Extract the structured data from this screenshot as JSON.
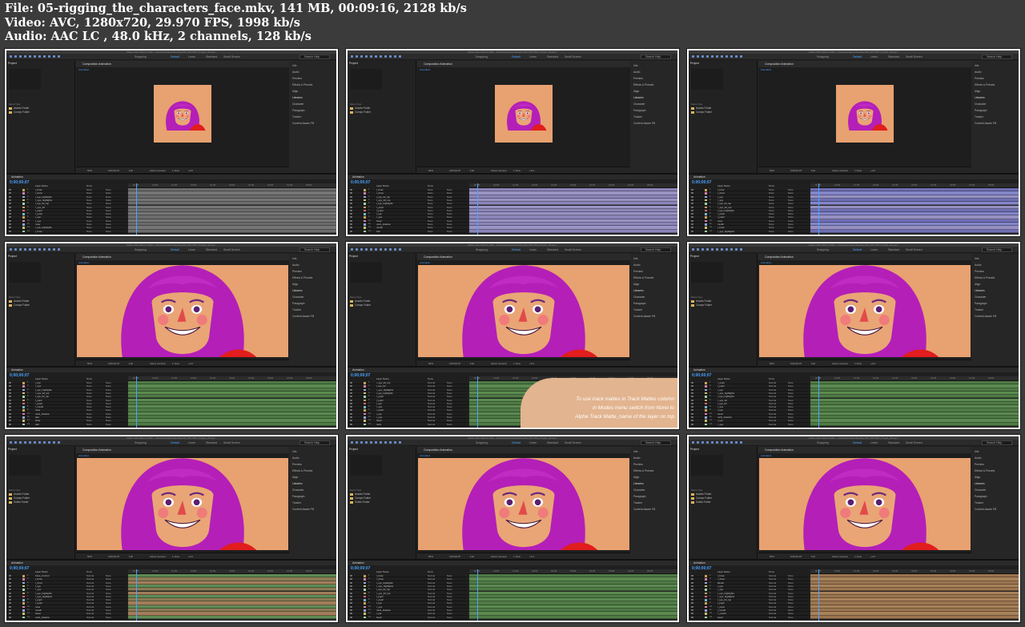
{
  "info": {
    "line1": "File: 05-rigging_the_characters_face.mkv, 141 MB, 00:09:16, 2128 kb/s",
    "line2": "Video: AVC, 1280x720, 29.970 FPS, 1998 kb/s",
    "line3": "Audio: AAC LC , 48.0 kHz, 2 channels, 128 kb/s"
  },
  "app": {
    "title": "Adobe After Effects 2020 - /Users/animation/Desktop/SS_MOTION_Project_02.aep *",
    "workspaces": [
      "Default",
      "Learn",
      "Standard",
      "Small Screen"
    ],
    "search_placeholder": "Search Help",
    "snapping": "Snapping",
    "project_label": "Project",
    "comp_tab": "Composition Animation",
    "comp_sub": "Animation",
    "timeline_tab": "Animation",
    "timecode": "0;00;00;07",
    "zoom": "50%",
    "resolution": "Full",
    "camera": "Active Camera",
    "views": "1 View",
    "offset": "+0.0",
    "columns": {
      "name": "Name",
      "type": "Type",
      "layer_name": "Layer Name",
      "mode": "Mode",
      "parent": "Parent & Link"
    },
    "folders": [
      {
        "name": "Assets",
        "type": "Folder"
      },
      {
        "name": "Comps",
        "type": "Folder"
      },
      {
        "name": "Solids",
        "type": "Folder"
      }
    ],
    "right_panel": [
      "Info",
      "Audio",
      "Preview",
      "Effects & Presets",
      "Align",
      "Libraries",
      "Character",
      "Paragraph",
      "Tracker",
      "Content-Aware Fill"
    ],
    "ruler_ticks": [
      "00:15f",
      "01:00f",
      "01:15f",
      "02:00f",
      "02:15f",
      "03:00f",
      "03:15f",
      "04:00f",
      "04:15f",
      "05:00f"
    ],
    "modes": [
      "None",
      "Normal",
      "Alpha"
    ]
  },
  "overlay": {
    "line1": "To use track mattes in Track Mattes column",
    "line2": "in Modes menu switch from None to",
    "line3": "Alpha Track Matte_name of the layer on top"
  },
  "thumbnails": [
    {
      "zoom": "full",
      "layers": [
        "l_brow",
        "r_brow",
        "l_eye_highlights",
        "r_eye_highlights",
        "l_eye_lid_top",
        "r_eye_lid",
        "l_pupil",
        "r_pupil",
        "l_eye",
        "r_eye",
        "nose",
        "l_eye_highlights",
        "l_brow"
      ],
      "tracks": "grey"
    },
    {
      "zoom": "full",
      "layers": [
        "l_brow",
        "r_brow",
        "l_eye_lid_top",
        "r_eye_lid_top",
        "l_eye_highlights",
        "r_pupil",
        "l_pupil",
        "l_eye",
        "r_eye",
        "head",
        "neck_shadow",
        "mouth",
        "hair"
      ],
      "tracks": "purple"
    },
    {
      "zoom": "full",
      "layers": [
        "l_brow",
        "r_brow",
        "l_eye",
        "r_eye",
        "l_eye_lid_top",
        "r_eye_lid_top",
        "l_eye_highlights",
        "r_pupil",
        "l_pupil",
        "nose",
        "mouth",
        "l_brow",
        "r_eye_highlights"
      ],
      "tracks": "purpleblue"
    },
    {
      "zoom": "zoom",
      "layers": [
        "l_eye",
        "r_eye",
        "l_eye_highlights",
        "r_eye_lid_top",
        "l_eye_lid_top",
        "l_pupil",
        "r_pupil",
        "l_mouth",
        "nose",
        "neck_shadow",
        "hair",
        "body",
        "hair"
      ],
      "tracks": "green"
    },
    {
      "zoom": "zoom",
      "layers": [
        "r_eye_lid_top",
        "l_eye_lid",
        "r_eye_highlights",
        "l_eye_highlights",
        "r_pupil",
        "l_pupil",
        "l_eye",
        "r_eye",
        "r_pupil",
        "l_eye",
        "r_eye",
        "head",
        "neck"
      ],
      "tracks": "greenwide"
    },
    {
      "zoom": "zoom",
      "layers": [
        "r_pupil",
        "l_pupil",
        "l_eye",
        "r_eye_highlights",
        "l_eye_highlights",
        "r_eye_lid",
        "l_eye_lid",
        "r_eye",
        "l_eye",
        "head",
        "neck_shadow",
        "l_eye",
        "r_eye"
      ],
      "tracks": "green"
    },
    {
      "zoom": "zoom",
      "layers": [
        "Face_Control",
        "l_brow",
        "r_brow",
        "l_eye",
        "r_eye",
        "l_eye_highlights",
        "r_eye_highlights",
        "l_pupil",
        "r_pupil",
        "nose",
        "mouth",
        "head",
        "neck_shadow"
      ],
      "tracks": "greenbrown"
    },
    {
      "zoom": "zoom",
      "layers": [
        "l_brow",
        "r_brow",
        "l_eye_highlights",
        "r_eye_highlights",
        "l_eye_lid_top",
        "r_eye_lid_top",
        "l_pupil",
        "r_pupil",
        "l_eye",
        "r_eye",
        "neck_shadow",
        "l_ear",
        "head"
      ],
      "tracks": "green"
    },
    {
      "zoom": "zoom",
      "layers": [
        "l_brow",
        "r_brow",
        "Mouth",
        "l_eye",
        "r_eye",
        "l_eye_highlights",
        "r_eye_highlights",
        "l_eye_lid_top",
        "l_pupil",
        "r_pupil",
        "l_mouth",
        "r_mouth",
        "head"
      ],
      "tracks": "brown"
    }
  ]
}
